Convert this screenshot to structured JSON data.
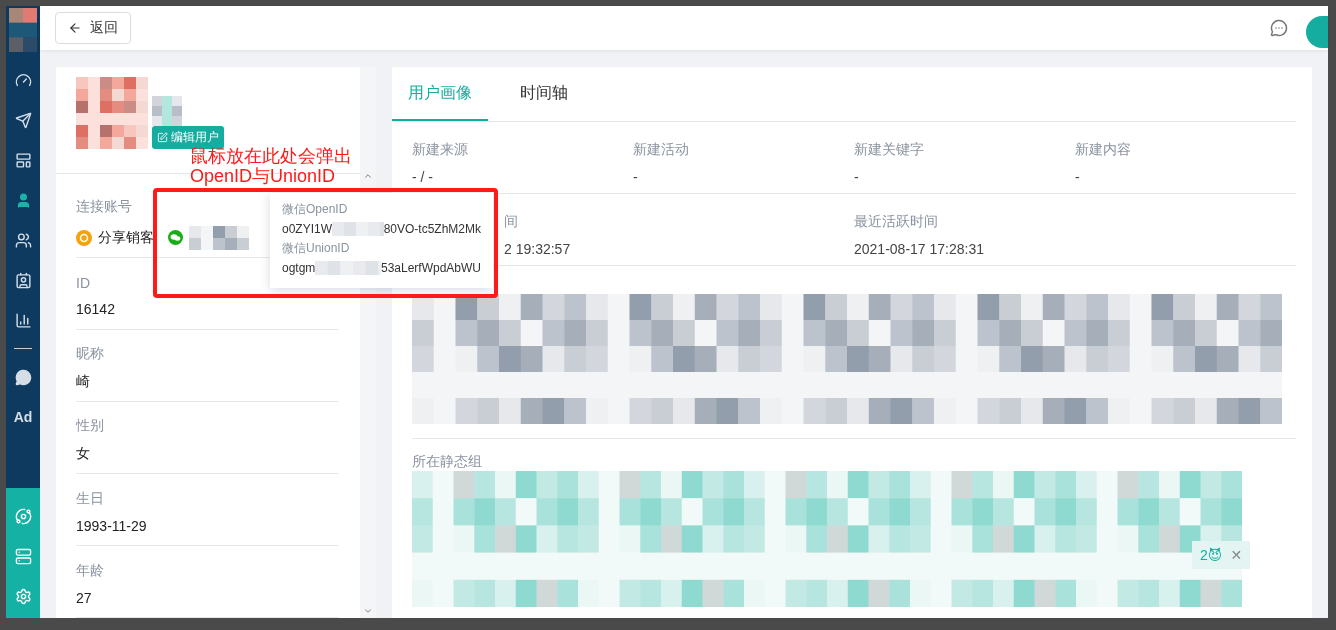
{
  "sidebar": {
    "items": [
      {
        "kind": "icon",
        "selected": false
      },
      {
        "kind": "icon",
        "selected": false
      },
      {
        "kind": "icon",
        "selected": false
      },
      {
        "kind": "icon",
        "selected": true
      },
      {
        "kind": "icon",
        "selected": false
      },
      {
        "kind": "icon",
        "selected": false
      },
      {
        "kind": "icon",
        "selected": false
      },
      {
        "kind": "divider"
      },
      {
        "kind": "icon",
        "selected": false
      },
      {
        "kind": "text",
        "label": "Ad",
        "selected": false
      }
    ]
  },
  "topbar": {
    "back_button": "返回"
  },
  "profile": {
    "edit_button": "编辑用户",
    "fields": [
      {
        "kind": "account",
        "label": "连接账号",
        "value": "分享销客"
      },
      {
        "kind": "text",
        "label": "ID",
        "value": "16142"
      },
      {
        "kind": "text",
        "label": "昵称",
        "value": "崎"
      },
      {
        "kind": "text",
        "label": "性别",
        "value": "女"
      },
      {
        "kind": "text",
        "label": "生日",
        "value": "1993-11-29"
      },
      {
        "kind": "text",
        "label": "年龄",
        "value": "27"
      }
    ]
  },
  "tabs": [
    {
      "label": "用户画像",
      "selected": true
    },
    {
      "label": "时间轴",
      "selected": false
    }
  ],
  "stats_rows": [
    [
      {
        "label": "新建来源",
        "value": "- / -"
      },
      {
        "label": "新建活动",
        "value": "-"
      },
      {
        "label": "新建关键字",
        "value": "-"
      },
      {
        "label": "新建内容",
        "value": "-"
      }
    ],
    [
      {
        "label": "间",
        "value": "2 19:32:57"
      },
      {},
      {
        "label": "最近活跃时间",
        "value": "2021-08-17 17:28:31"
      },
      {}
    ]
  ],
  "static_groups": {
    "label": "所在静态组",
    "tag": {
      "text": "2😈",
      "close": "✕"
    }
  },
  "popup": {
    "items": [
      {
        "label": "微信OpenID",
        "start": "o0ZYI1W",
        "end": "80VO-tc5ZhM2Mk"
      },
      {
        "label": "微信UnionID",
        "start": "ogtgm",
        "end": "53aLerfWpdAbWU"
      }
    ]
  },
  "annotation": {
    "text": "鼠标放在此处会弹出OpenID与UnionID"
  }
}
